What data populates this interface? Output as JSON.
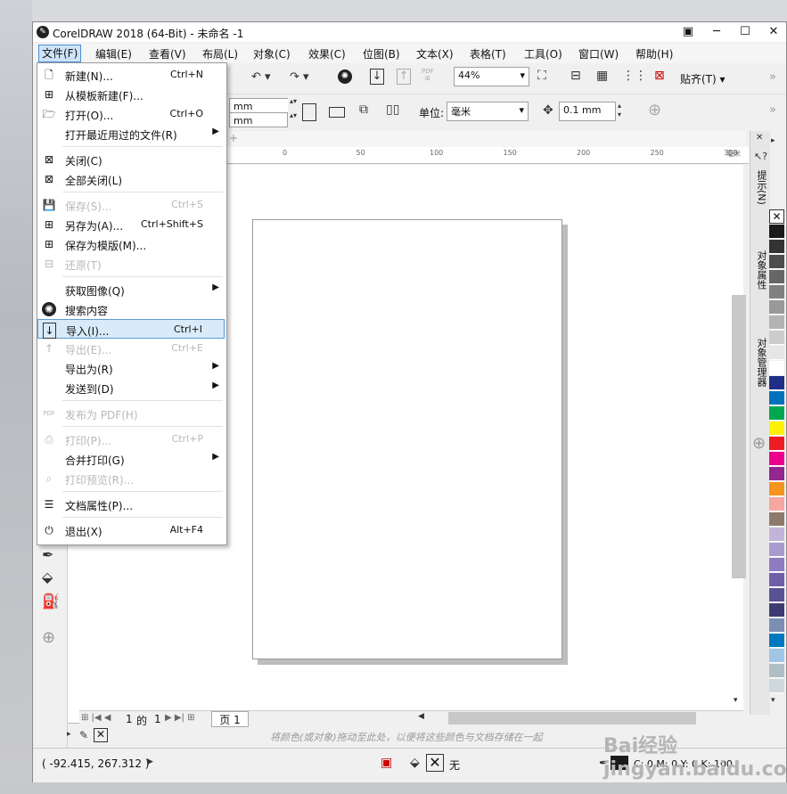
{
  "window": {
    "title": "CorelDRAW 2018 (64-Bit) - 未命名 -1"
  },
  "menubar": [
    "文件(F)",
    "编辑(E)",
    "查看(V)",
    "布局(L)",
    "对象(C)",
    "效果(C)",
    "位图(B)",
    "文本(X)",
    "表格(T)",
    "工具(O)",
    "窗口(W)",
    "帮助(H)"
  ],
  "file_menu": [
    {
      "label": "新建(N)...",
      "shortcut": "Ctrl+N",
      "icon": "new-doc-icon",
      "disabled": false,
      "sub": false
    },
    {
      "label": "从模板新建(F)...",
      "shortcut": "",
      "icon": "template-icon",
      "disabled": false,
      "sub": false
    },
    {
      "label": "打开(O)...",
      "shortcut": "Ctrl+O",
      "icon": "folder-icon",
      "disabled": false,
      "sub": false
    },
    {
      "label": "打开最近用过的文件(R)",
      "shortcut": "",
      "icon": "",
      "disabled": false,
      "sub": true
    },
    {
      "sep": true
    },
    {
      "label": "关闭(C)",
      "shortcut": "",
      "icon": "close-doc-icon",
      "disabled": false,
      "sub": false
    },
    {
      "label": "全部关闭(L)",
      "shortcut": "",
      "icon": "close-all-icon",
      "disabled": false,
      "sub": false
    },
    {
      "sep": true
    },
    {
      "label": "保存(S)...",
      "shortcut": "Ctrl+S",
      "icon": "save-icon",
      "disabled": true,
      "sub": false
    },
    {
      "label": "另存为(A)...",
      "shortcut": "Ctrl+Shift+S",
      "icon": "save-as-icon",
      "disabled": false,
      "sub": false
    },
    {
      "label": "保存为模版(M)...",
      "shortcut": "",
      "icon": "save-template-icon",
      "disabled": false,
      "sub": false
    },
    {
      "label": "还原(T)",
      "shortcut": "",
      "icon": "revert-icon",
      "disabled": true,
      "sub": false
    },
    {
      "sep": true
    },
    {
      "label": "获取图像(Q)",
      "shortcut": "",
      "icon": "",
      "disabled": false,
      "sub": true
    },
    {
      "label": "搜索内容",
      "shortcut": "",
      "icon": "search-content-icon",
      "disabled": false,
      "sub": false
    },
    {
      "label": "导入(I)...",
      "shortcut": "Ctrl+I",
      "icon": "import-icon",
      "disabled": false,
      "sub": false,
      "highlight": true
    },
    {
      "label": "导出(E)...",
      "shortcut": "Ctrl+E",
      "icon": "export-icon",
      "disabled": true,
      "sub": false
    },
    {
      "label": "导出为(R)",
      "shortcut": "",
      "icon": "",
      "disabled": false,
      "sub": true
    },
    {
      "label": "发送到(D)",
      "shortcut": "",
      "icon": "",
      "disabled": false,
      "sub": true
    },
    {
      "sep": true
    },
    {
      "label": "发布为 PDF(H)",
      "shortcut": "",
      "icon": "pdf-icon",
      "disabled": true,
      "sub": false
    },
    {
      "sep": true
    },
    {
      "label": "打印(P)...",
      "shortcut": "Ctrl+P",
      "icon": "print-icon",
      "disabled": true,
      "sub": false
    },
    {
      "label": "合并打印(G)",
      "shortcut": "",
      "icon": "",
      "disabled": false,
      "sub": true
    },
    {
      "label": "打印预览(R)...",
      "shortcut": "",
      "icon": "print-preview-icon",
      "disabled": true,
      "sub": false
    },
    {
      "sep": true
    },
    {
      "label": "文档属性(P)...",
      "shortcut": "",
      "icon": "doc-properties-icon",
      "disabled": false,
      "sub": false
    },
    {
      "sep": true
    },
    {
      "label": "退出(X)",
      "shortcut": "Alt+F4",
      "icon": "power-icon",
      "disabled": false,
      "sub": false
    }
  ],
  "toolbar": {
    "zoom": "44%",
    "snap": "贴齐(T)",
    "unit_label": "单位:",
    "unit": "毫米",
    "nudge": "0.1 mm",
    "w_unit": "mm",
    "h_unit": "mm"
  },
  "ruler": {
    "ticks": [
      "0",
      "50",
      "100",
      "150",
      "200",
      "250",
      "300"
    ],
    "unit": "毫米"
  },
  "dock_tabs": [
    "提示(N)",
    "对象属性",
    "对象管理器"
  ],
  "page_nav": {
    "current": "1",
    "of": "的",
    "total": "1",
    "tab": "页 1"
  },
  "palette_hint": "将颜色(或对象)拖动至此处，以便将这些颜色与文档存储在一起",
  "status": {
    "coords": "( -92.415, 267.312 )",
    "fill": "无",
    "outline": "C: 0 M: 0 Y: 0 K: 100"
  },
  "palette": [
    "#ffffff",
    "#1a1a1a",
    "#333333",
    "#4d4d4d",
    "#666666",
    "#808080",
    "#999999",
    "#b3b3b3",
    "#cccccc",
    "#e6e6e6",
    "#ffffff",
    "#1f2f88",
    "#0072bc",
    "#00a650",
    "#fff200",
    "#ed1c24",
    "#ec008c",
    "#92278f",
    "#f7941d",
    "#f5a7a0",
    "#8c7b6b",
    "#c0b5d8",
    "#a79cd0",
    "#8e7cc3",
    "#6f5ea8",
    "#5a5194",
    "#3d3c72",
    "#7b8fb5",
    "#0079c1",
    "#9fc6e7",
    "#b0bec5",
    "#cfd8dc"
  ],
  "watermark": "Bai经验 jingyan.baidu.com"
}
